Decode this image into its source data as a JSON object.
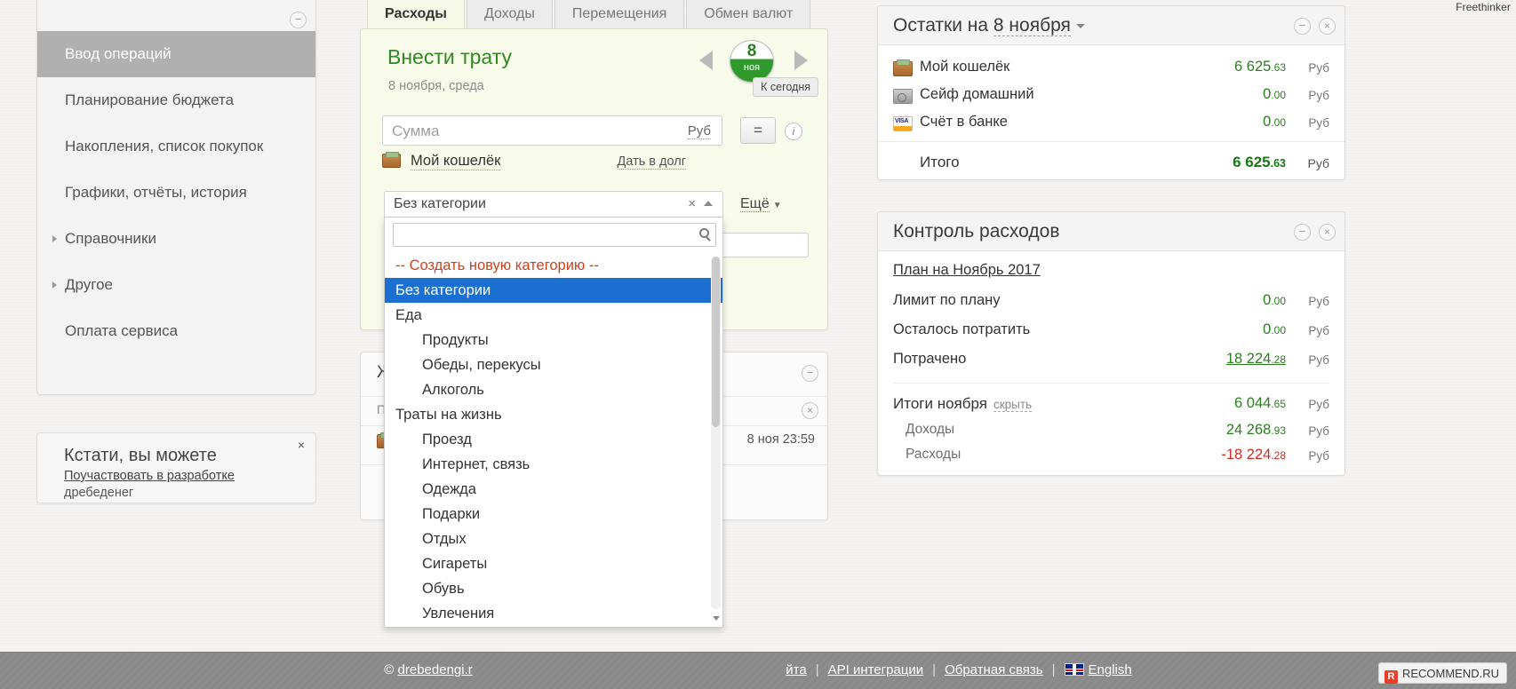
{
  "watermark": "Freethinker",
  "sidebar": {
    "items": [
      {
        "label": "Ввод операций",
        "active": true,
        "arrow": false
      },
      {
        "label": "Планирование бюджета",
        "active": false,
        "arrow": false
      },
      {
        "label": "Накопления, список покупок",
        "active": false,
        "arrow": false
      },
      {
        "label": "Графики, отчёты, история",
        "active": false,
        "arrow": false
      },
      {
        "label": "Справочники",
        "active": false,
        "arrow": true
      },
      {
        "label": "Другое",
        "active": false,
        "arrow": true
      },
      {
        "label": "Оплата сервиса",
        "active": false,
        "arrow": false
      }
    ],
    "collapse_icon": "−"
  },
  "promo": {
    "title": "Кстати, вы можете",
    "link": "Поучаствовать в разработке",
    "sub": "дребеденег",
    "close": "×"
  },
  "tabs": [
    {
      "label": "Расходы",
      "active": true
    },
    {
      "label": "Доходы",
      "active": false
    },
    {
      "label": "Перемещения",
      "active": false
    },
    {
      "label": "Обмен валют",
      "active": false
    }
  ],
  "entry": {
    "title": "Внести трату",
    "date_line": "8 ноября, среда",
    "badge_day": "8",
    "badge_month": "ноя",
    "today_button": "К сегодня",
    "amount_placeholder": "Сумма",
    "currency": "Руб",
    "equals_button": "=",
    "info_button": "i",
    "wallet": "Мой кошелёк",
    "lend_link": "Дать в долг",
    "more_link": "Ещё",
    "comment_value": ""
  },
  "dropdown": {
    "selected": "Без категории",
    "clear_icon": "×",
    "search_value": "",
    "items": [
      {
        "label": "-- Создать новую категорию --",
        "type": "create"
      },
      {
        "label": "Без категории",
        "type": "selected"
      },
      {
        "label": "Еда",
        "type": "group"
      },
      {
        "label": "Продукты",
        "type": "child"
      },
      {
        "label": "Обеды, перекусы",
        "type": "child"
      },
      {
        "label": "Алкоголь",
        "type": "child"
      },
      {
        "label": "Траты на жизнь",
        "type": "group"
      },
      {
        "label": "Проезд",
        "type": "child"
      },
      {
        "label": "Интернет, связь",
        "type": "child"
      },
      {
        "label": "Одежда",
        "type": "child"
      },
      {
        "label": "Подарки",
        "type": "child"
      },
      {
        "label": "Отдых",
        "type": "child"
      },
      {
        "label": "Сигареты",
        "type": "child"
      },
      {
        "label": "Обувь",
        "type": "child"
      },
      {
        "label": "Увлечения",
        "type": "child"
      }
    ]
  },
  "log_card": {
    "header": "Ж",
    "plan_label": "Пл",
    "time": "8 ноя 23:59"
  },
  "balances": {
    "title_prefix": "Остатки на ",
    "title_date": "8 ноября",
    "rows": [
      {
        "icon": "wallet-icon",
        "name": "Мой кошелёк",
        "amount": "6 625",
        "cents": ".63",
        "currency": "Руб"
      },
      {
        "icon": "safe-icon",
        "name": "Сейф домашний",
        "amount": "0",
        "cents": ".00",
        "currency": "Руб"
      },
      {
        "icon": "visa-icon",
        "name": "Счёт в банке",
        "amount": "0",
        "cents": ".00",
        "currency": "Руб"
      }
    ],
    "total_label": "Итого",
    "total_amount": "6 625",
    "total_cents": ".63",
    "total_currency": "Руб"
  },
  "control": {
    "title": "Контроль расходов",
    "plan_link": "План на Ноябрь 2017",
    "rows": [
      {
        "label": "Лимит по плану",
        "amount": "0",
        "cents": ".00",
        "currency": "Руб",
        "link": false
      },
      {
        "label": "Осталось потратить",
        "amount": "0",
        "cents": ".00",
        "currency": "Руб",
        "link": false
      },
      {
        "label": "Потрачено",
        "amount": "18 224",
        "cents": ".28",
        "currency": "Руб",
        "link": true
      }
    ],
    "summary_label": "Итоги ноября",
    "summary_hide": "скрыть",
    "summary_amount": "6 044",
    "summary_cents": ".65",
    "summary_currency": "Руб",
    "sub_rows": [
      {
        "label": "Доходы",
        "amount": "24 268",
        "cents": ".93",
        "currency": "Руб",
        "color": "green"
      },
      {
        "label": "Расходы",
        "amount": "-18 224",
        "cents": ".28",
        "currency": "Руб",
        "color": "red"
      }
    ]
  },
  "footer": {
    "copyright": "© ",
    "site": "drebedengi.r",
    "mail": "йта",
    "api": "API интеграции",
    "feedback": "Обратная связь",
    "language": "English",
    "separator": "|"
  },
  "recommend": {
    "mark": "R",
    "text": "RECOMMEND.RU"
  },
  "colors": {
    "accent_green": "#2b7d1f",
    "red": "#cc2b1e",
    "select_blue": "#1b6fd0",
    "create_orange": "#d0401c"
  }
}
